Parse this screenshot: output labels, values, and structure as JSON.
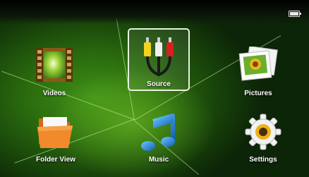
{
  "status": {
    "battery_icon": "battery-icon"
  },
  "menu": {
    "items": [
      {
        "label": "Videos",
        "icon": "film-icon"
      },
      {
        "label": "Source",
        "icon": "av-cable-icon",
        "selected": true
      },
      {
        "label": "Pictures",
        "icon": "photo-icon"
      },
      {
        "label": "Folder View",
        "icon": "folder-icon"
      },
      {
        "label": "Music",
        "icon": "music-note-icon"
      },
      {
        "label": "Settings",
        "icon": "gear-icon"
      }
    ]
  },
  "colors": {
    "selection_border": "#e8f2de",
    "label": "#ffffff"
  }
}
